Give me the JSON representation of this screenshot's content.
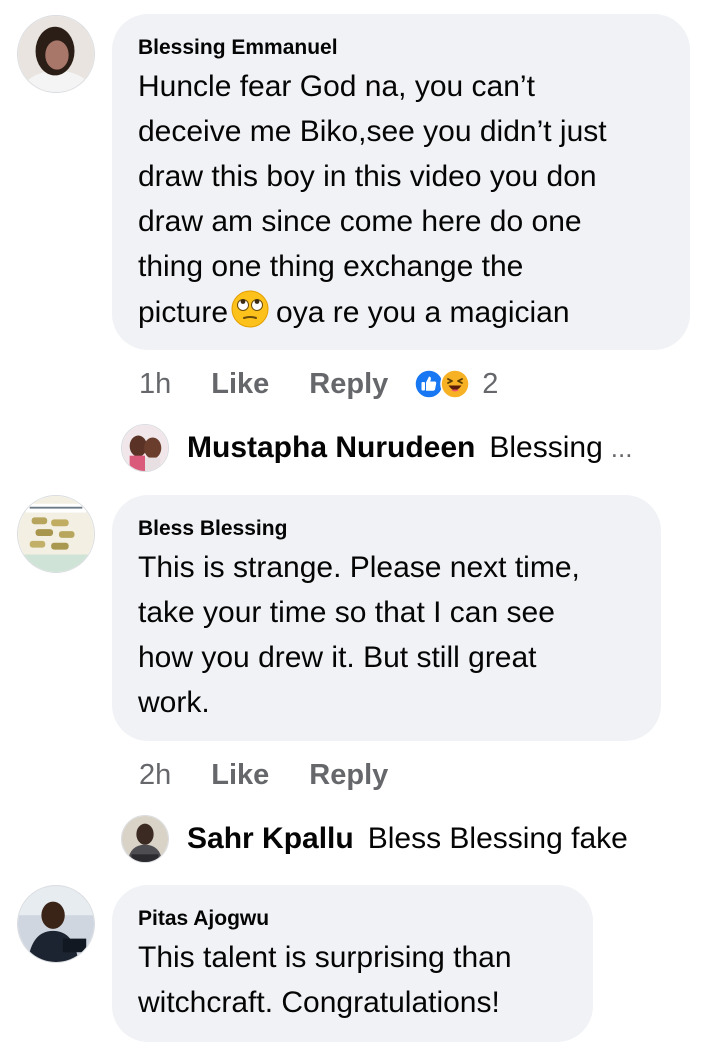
{
  "comments": [
    {
      "author": "Blessing Emmanuel",
      "lines": [
        "Huncle fear God na, you can’t",
        "deceive me Biko,see you didn’t just",
        "draw this boy in this video you don",
        "draw am since come here do one",
        "thing one thing exchange the"
      ],
      "last_line_before": "picture",
      "emoji": "face-with-rolling-eyes",
      "last_line_after": "oya re you a magician",
      "time": "1h",
      "like": "Like",
      "reply": "Reply",
      "reaction_count": "2",
      "reactions": [
        "like-reaction-icon",
        "haha-reaction-icon"
      ],
      "reply_preview": {
        "name": "Mustapha Nurudeen",
        "text": "Blessing",
        "ellipsis": "..."
      }
    },
    {
      "author": "Bless Blessing",
      "lines": [
        "This is strange. Please next time,",
        "take your time so that I can see",
        "how you drew it. But still great",
        "work."
      ],
      "time": "2h",
      "like": "Like",
      "reply": "Reply",
      "reply_preview": {
        "name": "Sahr Kpallu",
        "text": "Bless Blessing fake"
      }
    },
    {
      "author": "Pitas Ajogwu",
      "lines": [
        "This talent is surprising than",
        "witchcraft. Congratulations!"
      ]
    }
  ],
  "colors": {
    "bubble": "#f0f2f5",
    "text": "#050505",
    "secondary": "#65676b",
    "like_blue": "#1877f2",
    "haha_yellow": "#f7b125"
  }
}
